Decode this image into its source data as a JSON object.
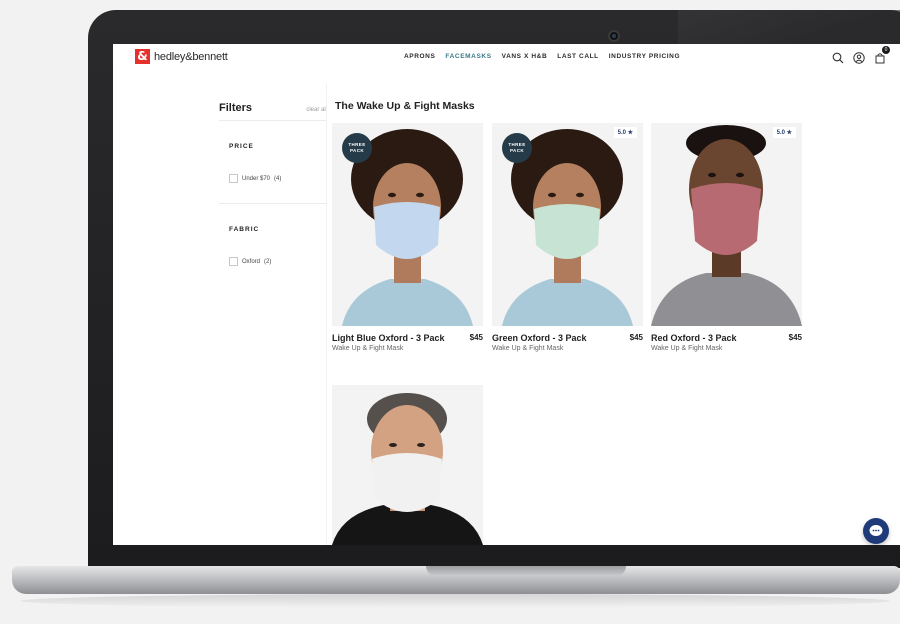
{
  "header": {
    "logo_mark": "&",
    "logo_text": "hedley&bennett",
    "nav": [
      {
        "label": "APRONS"
      },
      {
        "label": "FACEMASKS"
      },
      {
        "label": "VANS X H&B"
      },
      {
        "label": "LAST CALL"
      },
      {
        "label": "INDUSTRY PRICING"
      }
    ],
    "cart_count": "0",
    "icons": [
      "search-icon",
      "account-icon",
      "cart-icon"
    ]
  },
  "sidebar": {
    "title": "Filters",
    "clear_all": "clear all",
    "groups": [
      {
        "heading": "PRICE",
        "option": {
          "label": "Under $70",
          "count": "(4)"
        }
      },
      {
        "heading": "FABRIC",
        "option": {
          "label": "Oxford",
          "count": "(2)"
        }
      }
    ]
  },
  "collection": {
    "title": "The Wake Up & Fight Masks",
    "products": [
      {
        "name": "Light Blue Oxford - 3 Pack",
        "price": "$45",
        "subtitle": "Wake Up & Fight Mask",
        "badge": "THREE PACK",
        "rating": "",
        "mask_color": "#c3d8ee",
        "shirt_color": "#a9c9d8"
      },
      {
        "name": "Green Oxford - 3 Pack",
        "price": "$45",
        "subtitle": "Wake Up & Fight Mask",
        "badge": "THREE PACK",
        "rating": "5.0 ★",
        "mask_color": "#c6e3d3",
        "shirt_color": "#a9c9d8"
      },
      {
        "name": "Red Oxford - 3 Pack",
        "price": "$45",
        "subtitle": "Wake Up & Fight Mask",
        "badge": "",
        "rating": "5.0 ★",
        "mask_color": "#b86a72",
        "shirt_color": "#8f8f94"
      },
      {
        "name": "",
        "price": "",
        "subtitle": "",
        "badge": "",
        "rating": "",
        "mask_color": "#f1f1f1",
        "shirt_color": "#151515"
      }
    ]
  },
  "colors": {
    "brand_red": "#e4312b",
    "nav_active": "#3b7a8a",
    "badge_navy": "#253b4a",
    "chat_blue": "#1f3a78"
  }
}
